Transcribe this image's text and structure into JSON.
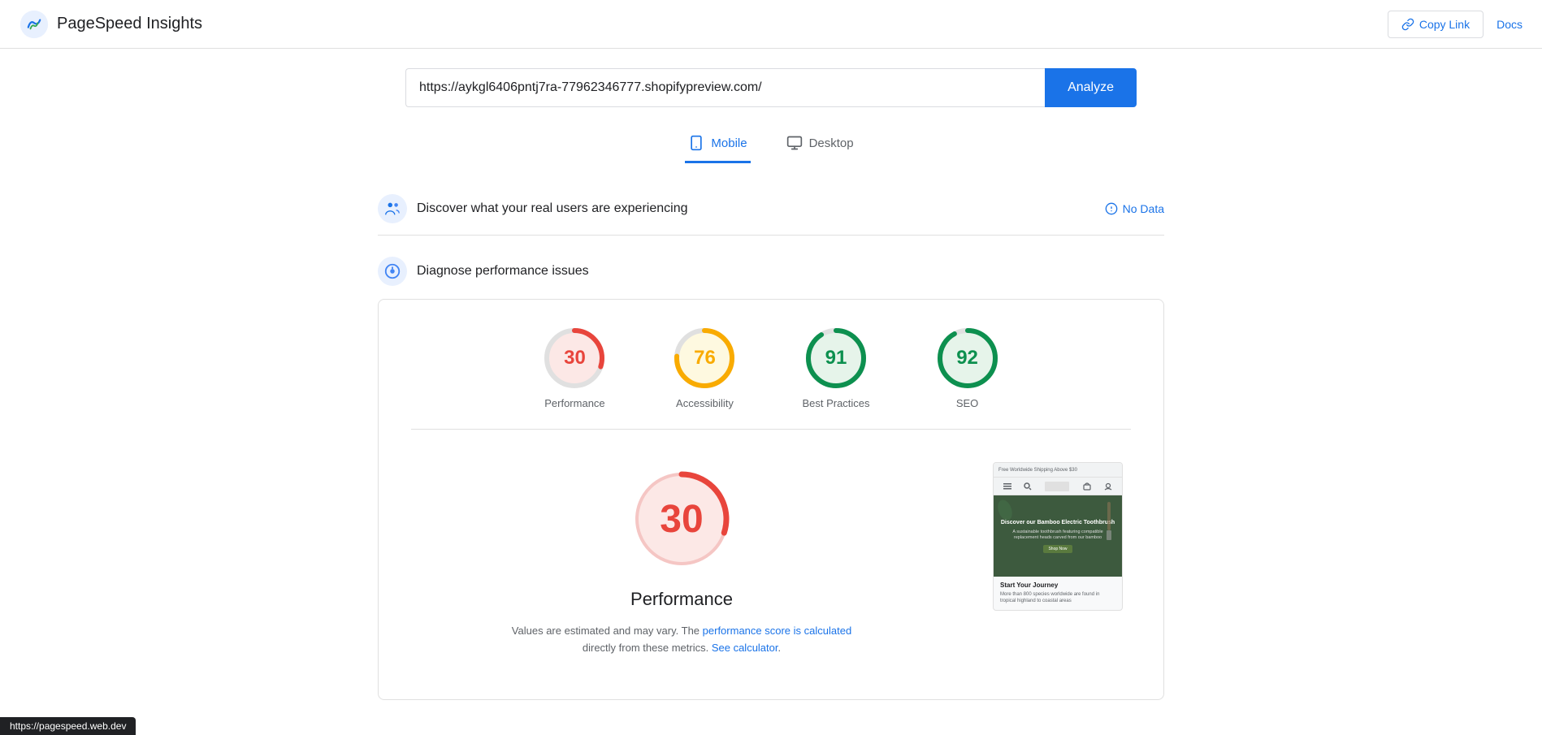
{
  "header": {
    "logo_text": "PageSpeed Insights",
    "copy_link_label": "Copy Link",
    "docs_label": "Docs"
  },
  "search": {
    "url_value": "https://aykgl6406pntj7ra-77962346777.shopifypreview.com/",
    "analyze_label": "Analyze"
  },
  "tabs": [
    {
      "id": "mobile",
      "label": "Mobile",
      "active": true
    },
    {
      "id": "desktop",
      "label": "Desktop",
      "active": false
    }
  ],
  "sections": {
    "real_users": {
      "title": "Discover what your real users are experiencing",
      "no_data_label": "No Data"
    },
    "diagnose": {
      "title": "Diagnose performance issues"
    }
  },
  "scores": [
    {
      "id": "performance",
      "label": "Performance",
      "value": 30,
      "color": "#e8453c",
      "bg": "#fce8e6",
      "pct": 30
    },
    {
      "id": "accessibility",
      "label": "Accessibility",
      "value": 76,
      "color": "#f9ab00",
      "bg": "#fef9e0",
      "pct": 76
    },
    {
      "id": "best-practices",
      "label": "Best Practices",
      "value": 91,
      "color": "#0d904f",
      "bg": "#e6f4ea",
      "pct": 91
    },
    {
      "id": "seo",
      "label": "SEO",
      "value": 92,
      "color": "#0d904f",
      "bg": "#e6f4ea",
      "pct": 92
    }
  ],
  "performance_detail": {
    "score": 30,
    "title": "Performance",
    "subtitle_part1": "Values are estimated and may vary. The",
    "subtitle_link1": "performance score is calculated",
    "subtitle_part2": "directly from these metrics.",
    "subtitle_link2": "See calculator",
    "subtitle_end": "."
  },
  "screenshot": {
    "banner": "Free Worldwide Shipping Above $30",
    "heading": "Discover our Bamboo Electric Toothbrush",
    "body": "A sustainable toothbrush featuring compatible replacement heads carved from our bamboo",
    "btn": "Shop Now",
    "bottom_title": "Start Your Journey",
    "bottom_text": "More than 800 species worldwide are found in tropical highland to coastal areas"
  },
  "status_bar": {
    "url": "https://pagespeed.web.dev"
  }
}
